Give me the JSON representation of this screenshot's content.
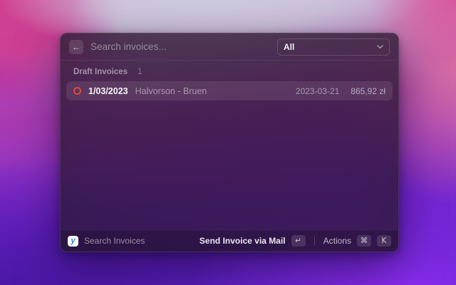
{
  "window": {
    "search": {
      "value": "",
      "placeholder": "Search invoices..."
    },
    "filter": {
      "selected": "All"
    },
    "section": {
      "title": "Draft Invoices",
      "count": "1"
    },
    "rows": [
      {
        "title": "1/03/2023",
        "subtitle": "Halvorson - Bruen",
        "date": "2023-03-21",
        "amount": "865,92 zł",
        "status_icon": "red-ring"
      }
    ],
    "footer": {
      "command_label": "Search Invoices",
      "primary_action": "Send Invoice via Mail",
      "primary_key": "↵",
      "actions_label": "Actions",
      "actions_key_1": "⌘",
      "actions_key_2": "K"
    }
  },
  "icons": {
    "back": "back-arrow-icon",
    "dropdown": "chevron-down-icon",
    "app": "invoice-app-logo",
    "row_status": "draft-status-ring-icon"
  },
  "colors": {
    "status_ring_red": "#e3473c",
    "app_logo_blue": "#2f7de1",
    "selection_highlight": "rgba(255,255,255,0.09)"
  }
}
